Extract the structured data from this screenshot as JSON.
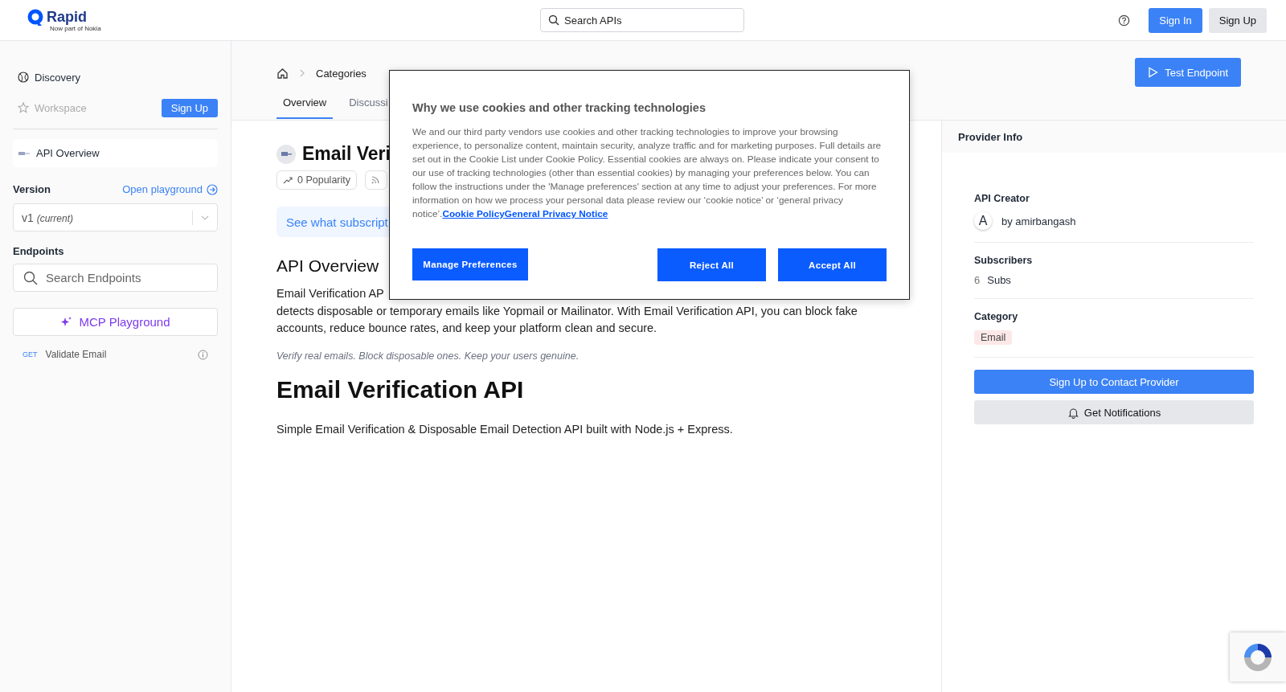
{
  "header": {
    "logo": "Rapid",
    "logo_tagline": "Now part of Nokia",
    "search": {
      "placeholder": "Search APIs"
    },
    "buttons": [
      "Sign In",
      "Sign Up"
    ]
  },
  "sidebar": {
    "nav": [
      {
        "label": "Discovery",
        "disabled": false
      },
      {
        "label": "Workspace",
        "disabled": true
      }
    ],
    "signup": "Sign Up",
    "overview": "API Overview",
    "version_label": "Version",
    "playground_link": "Open playground",
    "version": {
      "value": "v1",
      "note": "(current)"
    },
    "endpoints_label": "Endpoints",
    "endpoint_search": {
      "placeholder": "Search Endpoints"
    },
    "mcp": "MCP Playground",
    "endpoints": [
      {
        "method": "GET",
        "name": "Validate Email"
      }
    ]
  },
  "breadcrumb": [
    "Categories"
  ],
  "tabs": [
    {
      "label": "Overview",
      "selected": true
    },
    {
      "label": "Discussi",
      "selected": false
    }
  ],
  "test_button": "Test Endpoint",
  "api": {
    "title": "Email Veri",
    "popularity": "0 Popularity",
    "banner": "See what subscript",
    "section": "API Overview",
    "lead_line": "Email Verification AP",
    "description": "detects disposable or temporary emails like Yopmail or Mailinator. With Email Verification API, you can block fake accounts, reduce bounce rates, and keep your platform clean and secure.",
    "tagline": "Verify real emails. Block disposable ones. Keep your users genuine.",
    "heading": "Email Verification API",
    "summary": "Simple Email Verification & Disposable Email Detection API built with Node.js + Express."
  },
  "provider": {
    "title": "Provider Info",
    "creator_label": "API Creator",
    "avatar": "A",
    "creator": "by amirbangash",
    "subscribers_label": "Subscribers",
    "subscribers_count": "6",
    "subscribers_unit": "Subs",
    "category_label": "Category",
    "category": "Email",
    "contact_button": "Sign Up to Contact Provider",
    "notify_button": "Get Notifications"
  },
  "cookie_dialog": {
    "title": "Why we use cookies and other tracking technologies",
    "body": "We and our third party vendors use cookies and other tracking technologies to improve your browsing experience, to personalize content, maintain security, analyze traffic and for marketing purposes. Full details are set out in the Cookie List under Cookie Policy. Essential cookies are always on. Please indicate your consent to our use of tracking technologies (other than essential cookies) by managing your preferences below. You can follow the instructions under the 'Manage preferences' section at any time to adjust your preferences. For more information on how we process your personal data please review our ‘cookie notice’ or ‘general privacy notice’.",
    "links": [
      "Cookie Policy",
      "General Privacy Notice"
    ],
    "buttons": [
      "Manage Preferences",
      "Reject All",
      "Accept All"
    ]
  }
}
